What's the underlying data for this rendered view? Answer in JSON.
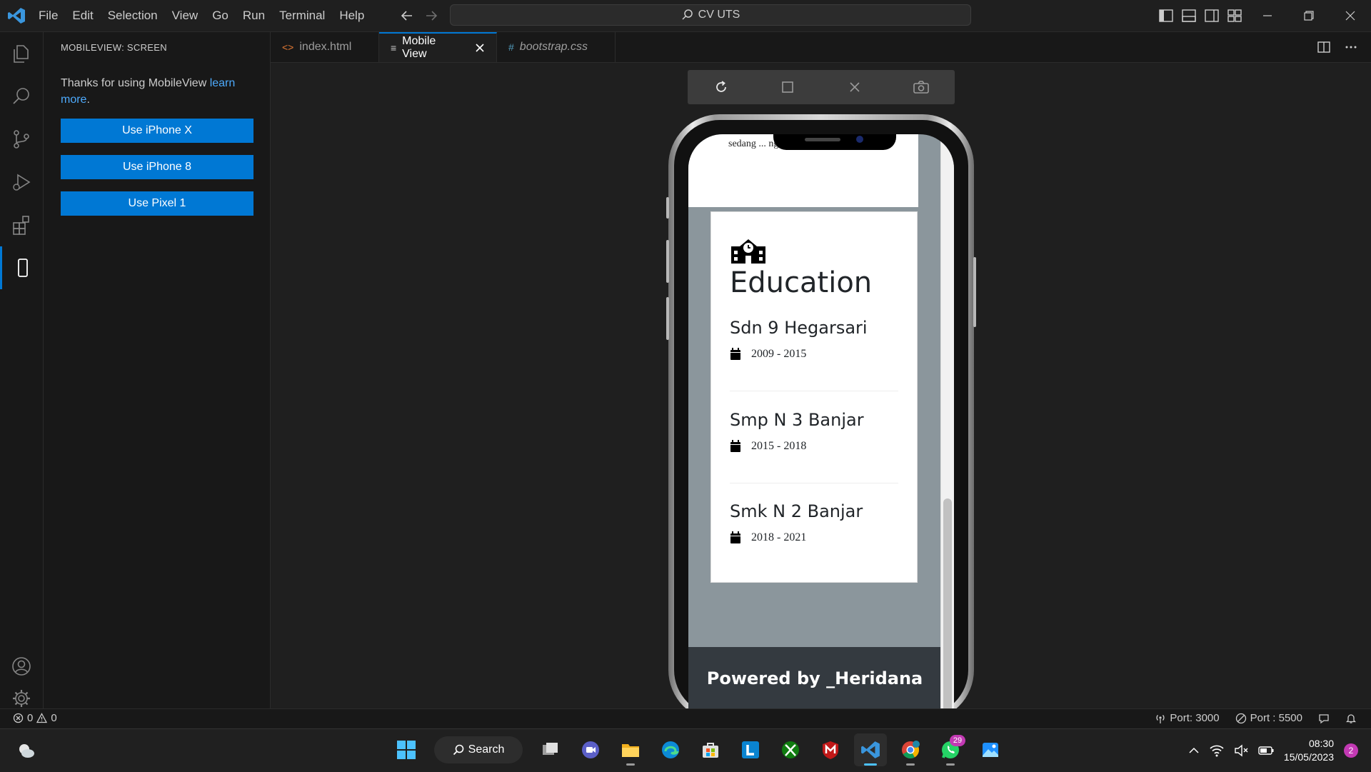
{
  "titlebar": {
    "menu": [
      "File",
      "Edit",
      "Selection",
      "View",
      "Go",
      "Run",
      "Terminal",
      "Help"
    ],
    "search_text": "CV UTS"
  },
  "sidebar": {
    "title": "MOBILEVIEW: SCREEN",
    "message_prefix": "Thanks for using MobileView ",
    "message_link": "learn more",
    "message_suffix": ".",
    "buttons": [
      "Use iPhone X",
      "Use iPhone 8",
      "Use Pixel 1"
    ]
  },
  "tabs": [
    {
      "label": "index.html",
      "icon": "<>",
      "active": false
    },
    {
      "label": "Mobile View",
      "icon": "≡",
      "active": true
    },
    {
      "label": "bootstrap.css",
      "icon": "#",
      "active": false
    }
  ],
  "phone": {
    "cut_text": "sedang ... ng ... g",
    "education_title": "Education",
    "schools": [
      {
        "name": "Sdn 9 Hegarsari",
        "years": "2009 - 2015"
      },
      {
        "name": "Smp N 3 Banjar",
        "years": "2015 - 2018"
      },
      {
        "name": "Smk N 2 Banjar",
        "years": "2018 - 2021"
      }
    ],
    "footer": "Powered by _Heridana"
  },
  "statusbar": {
    "errors": "0",
    "warnings": "0",
    "port1": "Port: 3000",
    "port2": "Port : 5500"
  },
  "taskbar": {
    "search_label": "Search",
    "whatsapp_badge": "29",
    "time": "08:30",
    "date": "15/05/2023",
    "notifications": "2"
  },
  "colors": {
    "accent": "#0078d4",
    "editor_bg": "#1f1f1f",
    "footer_bg": "#343a40"
  }
}
